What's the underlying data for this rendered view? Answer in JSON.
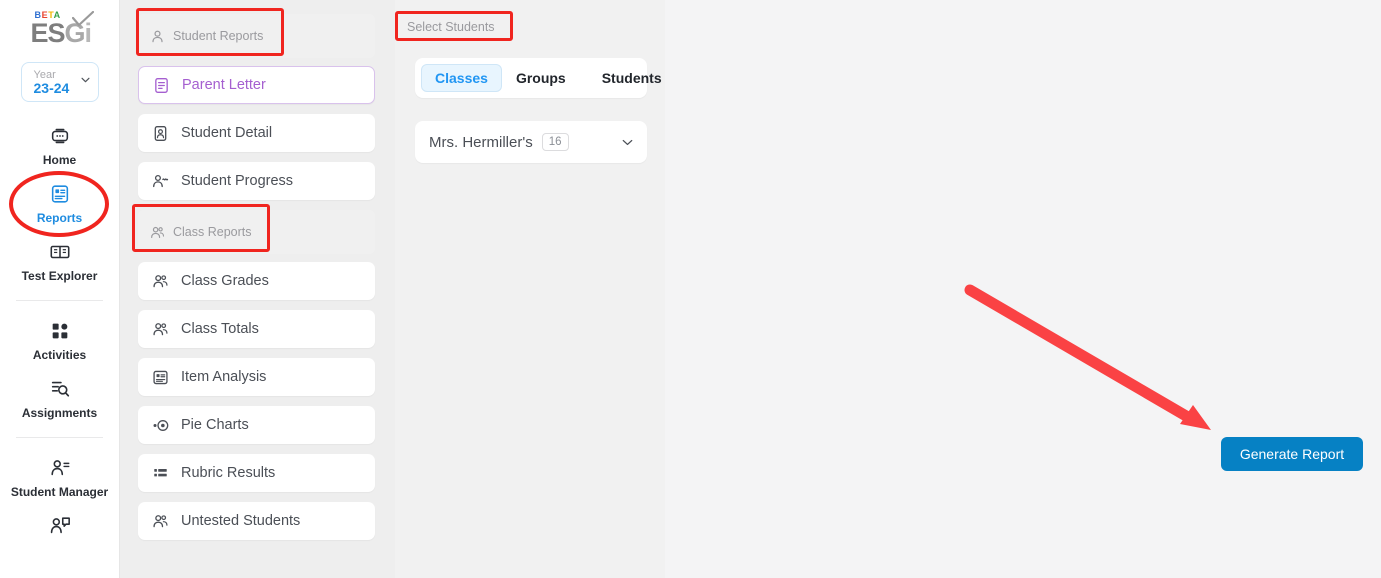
{
  "brand": {
    "beta_letters": [
      "B",
      "E",
      "T",
      "A"
    ],
    "name": "ESGi",
    "colors": {
      "beta_b": "#2f6fd0",
      "beta_e": "#e8432e",
      "beta_t": "#f2b705",
      "beta_a": "#35a04a",
      "accent_blue": "#1f8ce0",
      "primary_button": "#0681c4",
      "highlight_red": "#f0251f",
      "selected_purple": "#a55fd0"
    }
  },
  "sidebar": {
    "year_selector": {
      "label": "Year",
      "value": "23-24",
      "icon": "chevron-down-icon"
    },
    "items": [
      {
        "label": "Home",
        "icon": "home-icon",
        "active": false
      },
      {
        "label": "Reports",
        "icon": "reports-icon",
        "active": true
      },
      {
        "label": "Test Explorer",
        "icon": "book-icon",
        "active": false
      },
      {
        "label": "Activities",
        "icon": "grid-icon",
        "active": false
      },
      {
        "label": "Assignments",
        "icon": "assignment-search-icon",
        "active": false
      },
      {
        "label": "Student Manager",
        "icon": "person-list-icon",
        "active": false
      },
      {
        "label": "",
        "icon": "person-chat-icon",
        "active": false
      }
    ]
  },
  "reports_panel": {
    "student_section": {
      "header": "Student Reports",
      "header_icon": "person-icon",
      "items": [
        {
          "label": "Parent Letter",
          "icon": "document-icon",
          "selected": true
        },
        {
          "label": "Student Detail",
          "icon": "student-card-icon",
          "selected": false
        },
        {
          "label": "Student Progress",
          "icon": "person-progress-icon",
          "selected": false
        }
      ]
    },
    "class_section": {
      "header": "Class Reports",
      "header_icon": "people-icon",
      "items": [
        {
          "label": "Class Grades",
          "icon": "people-icon",
          "selected": false
        },
        {
          "label": "Class Totals",
          "icon": "people-icon",
          "selected": false
        },
        {
          "label": "Item Analysis",
          "icon": "analysis-icon",
          "selected": false
        },
        {
          "label": "Pie Charts",
          "icon": "pie-chart-icon",
          "selected": false
        },
        {
          "label": "Rubric Results",
          "icon": "rubric-grid-icon",
          "selected": false
        },
        {
          "label": "Untested Students",
          "icon": "people-icon",
          "selected": false
        }
      ]
    }
  },
  "select_students": {
    "header": "Select Students",
    "tabs": [
      {
        "label": "Classes",
        "active": true
      },
      {
        "label": "Groups",
        "active": false
      },
      {
        "label": "Students",
        "active": false
      }
    ],
    "class_dropdown": {
      "name": "Mrs. Hermiller's",
      "count": "16",
      "icon": "chevron-down-icon"
    }
  },
  "main": {
    "generate_button": "Generate Report"
  }
}
